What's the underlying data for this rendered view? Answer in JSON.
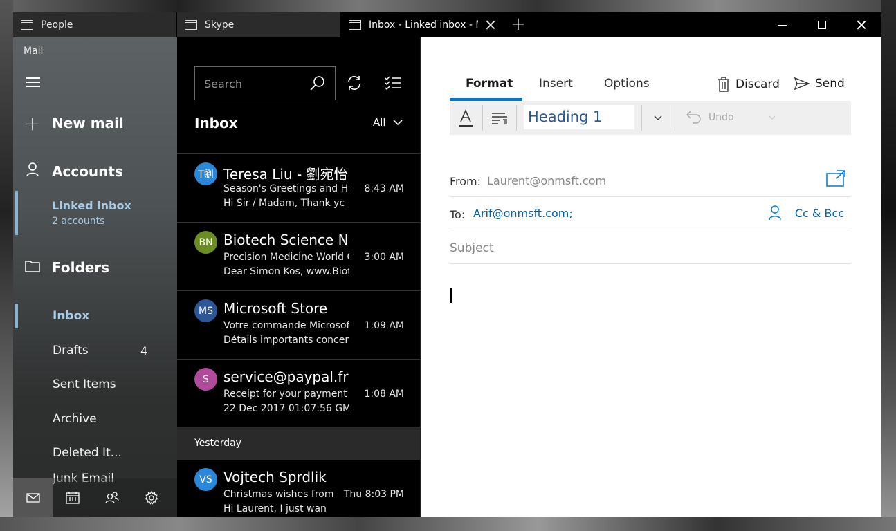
{
  "tabs": [
    {
      "title": "People"
    },
    {
      "title": "Skype"
    },
    {
      "title": "Inbox - Linked inbox - M"
    }
  ],
  "nav": {
    "app_name": "Mail",
    "new_mail": "New mail",
    "accounts": "Accounts",
    "linked_inbox": "Linked inbox",
    "linked_accounts": "2 accounts",
    "folders_label": "Folders",
    "folders": [
      {
        "label": "Inbox",
        "count": ""
      },
      {
        "label": "Drafts",
        "count": "4"
      },
      {
        "label": "Sent Items",
        "count": ""
      },
      {
        "label": "Archive",
        "count": ""
      },
      {
        "label": "Deleted It...",
        "count": ""
      },
      {
        "label": "Junk Email",
        "count": ""
      }
    ]
  },
  "list": {
    "search_placeholder": "Search",
    "title": "Inbox",
    "filter": "All",
    "messages": [
      {
        "initials": "T劉",
        "color": "#2b88d8",
        "from": "Teresa Liu - 劉宛怡",
        "subject": "Season's Greetings and Ha",
        "preview": "Hi Sir / Madam,    Thank yc",
        "time": "8:43 AM"
      },
      {
        "initials": "BN",
        "color": "#6b8e23",
        "from": "Biotech Science New",
        "subject": "Precision Medicine World C",
        "preview": "Dear Simon Kos,  www.Biot",
        "time": "3:00 AM"
      },
      {
        "initials": "MS",
        "color": "#2b5797",
        "from": "Microsoft Store",
        "subject": "Votre commande Microsof",
        "preview": "Détails importants concern",
        "time": "1:09 AM"
      },
      {
        "initials": "S",
        "color": "#b04a9a",
        "from": "service@paypal.fr",
        "subject": "Receipt for your payment t",
        "preview": "22 Dec 2017 01:07:56 GMT",
        "time": "1:08 AM"
      }
    ],
    "day_header": "Yesterday",
    "messages_yesterday": [
      {
        "initials": "VS",
        "color": "#2b88d8",
        "from": "Vojtech Sprdlik",
        "subject": "Christmas wishes from",
        "preview": "Hi Laurent,    I just wan",
        "time": "Thu 8:03 PM"
      }
    ]
  },
  "compose": {
    "tabs": [
      "Format",
      "Insert",
      "Options"
    ],
    "discard": "Discard",
    "send": "Send",
    "style": "Heading 1",
    "undo": "Undo",
    "from_label": "From:",
    "from_value": "Laurent@onmsft.com",
    "to_label": "To:",
    "to_value": "Arif@onmsft.com;",
    "cc_bcc": "Cc & Bcc",
    "subject_placeholder": "Subject"
  },
  "colors": {
    "accent": "#0078d7",
    "nav_selected": "#a9cbe6"
  }
}
